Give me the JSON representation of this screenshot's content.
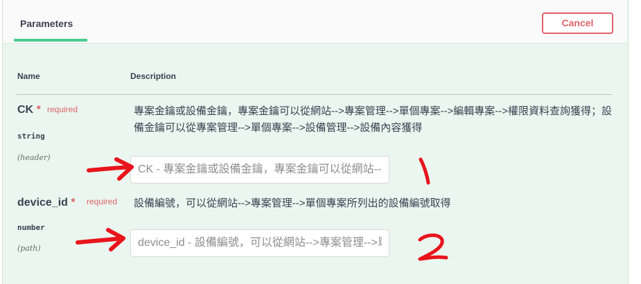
{
  "header": {
    "tab_label": "Parameters",
    "cancel_label": "Cancel"
  },
  "columns": {
    "name": "Name",
    "description": "Description"
  },
  "parameters": [
    {
      "name": "CK",
      "required_marker": "*",
      "required_label": "required",
      "type": "string",
      "in": "(header)",
      "description": "專案金鑰或設備金鑰，專案金鑰可以從網站-->專案管理-->單個專案-->編輯專案-->權限資料查詢獲得；設備金鑰可以從專案管理-->單個專案-->設備管理-->設備內容獲得",
      "placeholder": "CK - 專案金鑰或設備金鑰，專案金鑰可以從網站-->專案管理-->單個專案-->編輯專案-->權限資料查詢獲得"
    },
    {
      "name": "device_id",
      "required_marker": "*",
      "required_label": "required",
      "type": "number",
      "in": "(path)",
      "description": "設備編號，可以從網站-->專案管理-->單個專案所列出的設備編號取得",
      "placeholder": "device_id - 設備編號，可以從網站-->專案管理-->單個專案所列出的設備編號取得"
    }
  ],
  "annotations": {
    "mark_1": "1",
    "mark_2": "2",
    "color": "#e8141c"
  },
  "colors": {
    "panel_bg": "#eaf6ef",
    "accent_green": "#49cc90",
    "danger_red": "#e0636a"
  }
}
